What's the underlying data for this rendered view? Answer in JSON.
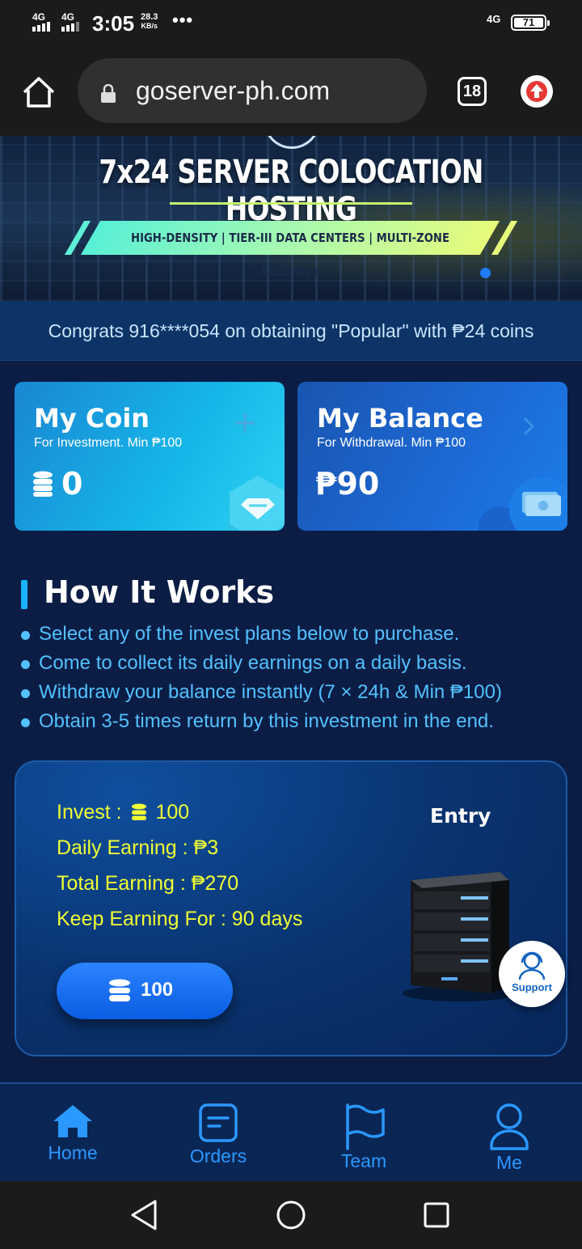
{
  "status_bar": {
    "signal1": "4G",
    "signal2": "4G",
    "time": "3:05",
    "net_speed_value": "28.3",
    "net_speed_unit": "KB/s",
    "more": "•••",
    "network_right": "4G",
    "battery": "71"
  },
  "browser": {
    "url": "goserver-ph.com",
    "tab_count": "18"
  },
  "banner": {
    "title": "7x24 SERVER COLOCATION HOSTING",
    "strip_text": "HIGH-DENSITY | TIER-III DATA CENTERS | MULTI-ZONE SECURITY",
    "slide_count": 1,
    "active_slide": 1
  },
  "marquee": {
    "text": "Congrats 916****054 on obtaining \"Popular\" with ₱24 coins"
  },
  "coin_card": {
    "title": "My Coin",
    "subtitle": "For Investment. Min ₱100",
    "value": "0"
  },
  "balance_card": {
    "title": "My Balance",
    "subtitle": "For Withdrawal. Min ₱100",
    "value": "₱90"
  },
  "how_it_works": {
    "title": "How It Works",
    "items": [
      "Select any of the invest plans below to purchase.",
      "Come to collect its daily earnings on a daily basis.",
      "Withdraw your balance instantly (7 × 24h & Min ₱100)",
      "Obtain 3-5 times return by this investment in the end."
    ]
  },
  "plan": {
    "name": "Entry",
    "invest_label": "Invest :",
    "invest_value": "100",
    "daily": "Daily Earning : ₱3",
    "total": "Total Earning : ₱270",
    "duration": "Keep Earning For : 90 days",
    "button_label": "100"
  },
  "support": {
    "label": "Support"
  },
  "bottom_nav": {
    "items": [
      {
        "label": "Home",
        "icon": "home-icon",
        "active": true
      },
      {
        "label": "Orders",
        "icon": "orders-icon",
        "active": false
      },
      {
        "label": "Team",
        "icon": "flag-icon",
        "active": false
      },
      {
        "label": "Me",
        "icon": "person-icon",
        "active": false
      }
    ]
  },
  "colors": {
    "accent": "#2a98ff",
    "plan_text": "#f0ff34",
    "page_bg": "#0b1d45"
  }
}
